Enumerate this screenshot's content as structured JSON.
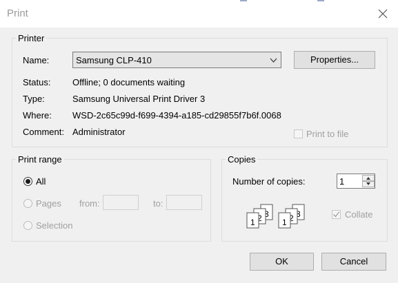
{
  "window": {
    "title": "Print"
  },
  "printer": {
    "group_title": "Printer",
    "name_label": "Name:",
    "selected_printer": "Samsung CLP-410",
    "properties_button": "Properties...",
    "status_label": "Status:",
    "status_value": "Offline; 0 documents waiting",
    "type_label": "Type:",
    "type_value": "Samsung Universal Print Driver 3",
    "where_label": "Where:",
    "where_value": "WSD-2c65c99d-f699-4394-a185-cd29855f7b6f.0068",
    "comment_label": "Comment:",
    "comment_value": "Administrator",
    "print_to_file_label": "Print to file",
    "print_to_file_checked": false
  },
  "print_range": {
    "group_title": "Print range",
    "options": [
      {
        "label": "All",
        "checked": true,
        "enabled": true
      },
      {
        "label": "Pages",
        "checked": false,
        "enabled": false
      },
      {
        "label": "Selection",
        "checked": false,
        "enabled": false
      }
    ],
    "from_label": "from:",
    "to_label": "to:"
  },
  "copies": {
    "group_title": "Copies",
    "number_label": "Number of copies:",
    "number_value": "1",
    "collate_label": "Collate",
    "collate_checked": true,
    "collate_icon_digits": [
      "1",
      "2",
      "3"
    ]
  },
  "footer": {
    "ok_label": "OK",
    "cancel_label": "Cancel"
  }
}
